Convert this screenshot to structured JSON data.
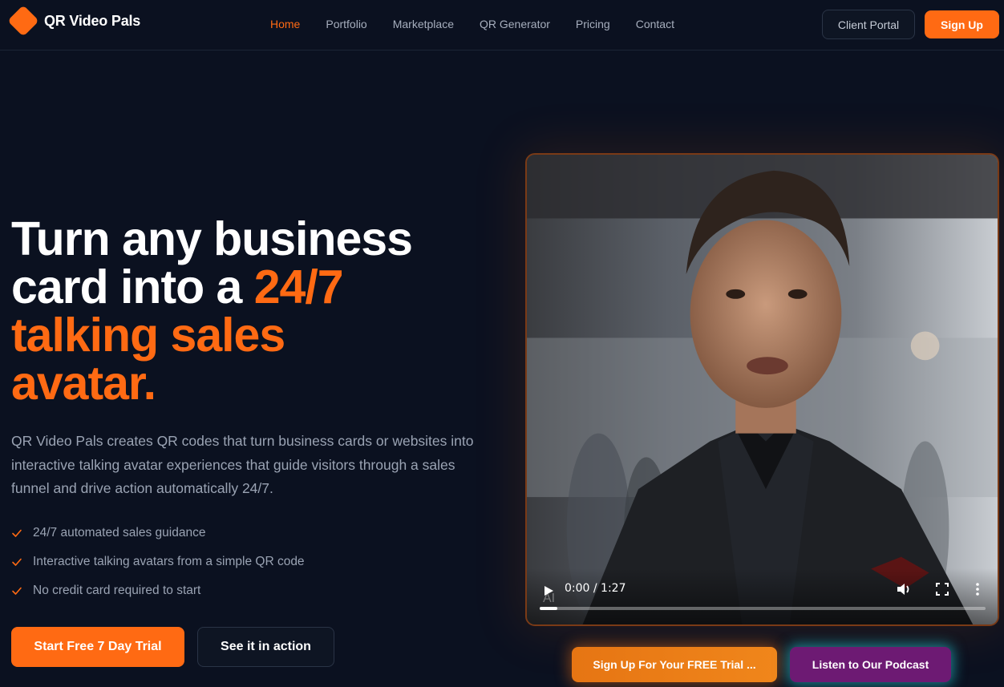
{
  "brand": {
    "name": "QR Video Pals",
    "accent_color": "#ff6a13"
  },
  "nav": {
    "links": [
      {
        "label": "Home",
        "active": true
      },
      {
        "label": "Portfolio",
        "active": false
      },
      {
        "label": "Marketplace",
        "active": false
      },
      {
        "label": "QR Generator",
        "active": false
      },
      {
        "label": "Pricing",
        "active": false
      },
      {
        "label": "Contact",
        "active": false
      }
    ],
    "client_portal_label": "Client Portal",
    "signup_label": "Sign Up"
  },
  "hero": {
    "title_line1": "Turn any business",
    "title_line2_white": "card into a ",
    "title_line2_accent": "24/7",
    "title_line3_accent": "talking sales",
    "title_line4_accent": "avatar.",
    "description": "QR Video Pals creates QR codes that turn business cards or websites into interactive talking avatar experiences that guide visitors through a sales funnel and drive action automatically 24/7.",
    "features": [
      "24/7 automated sales guidance",
      "Interactive talking avatars from a simple QR code",
      "No credit card required to start"
    ],
    "primary_cta": "Start Free 7 Day Trial",
    "secondary_cta": "See it in action"
  },
  "video": {
    "time_display": "0:00 / 1:27",
    "progress": 0.04,
    "watermark": "AI",
    "icons": [
      "play-icon",
      "volume-icon",
      "fullscreen-icon",
      "more-options-icon"
    ]
  },
  "bottom_buttons": {
    "free_trial_label": "Sign Up For Your FREE Trial ...",
    "podcast_label": "Listen to Our Podcast",
    "podcast_color": "#6d1a73",
    "podcast_glow": "#28dce6"
  }
}
